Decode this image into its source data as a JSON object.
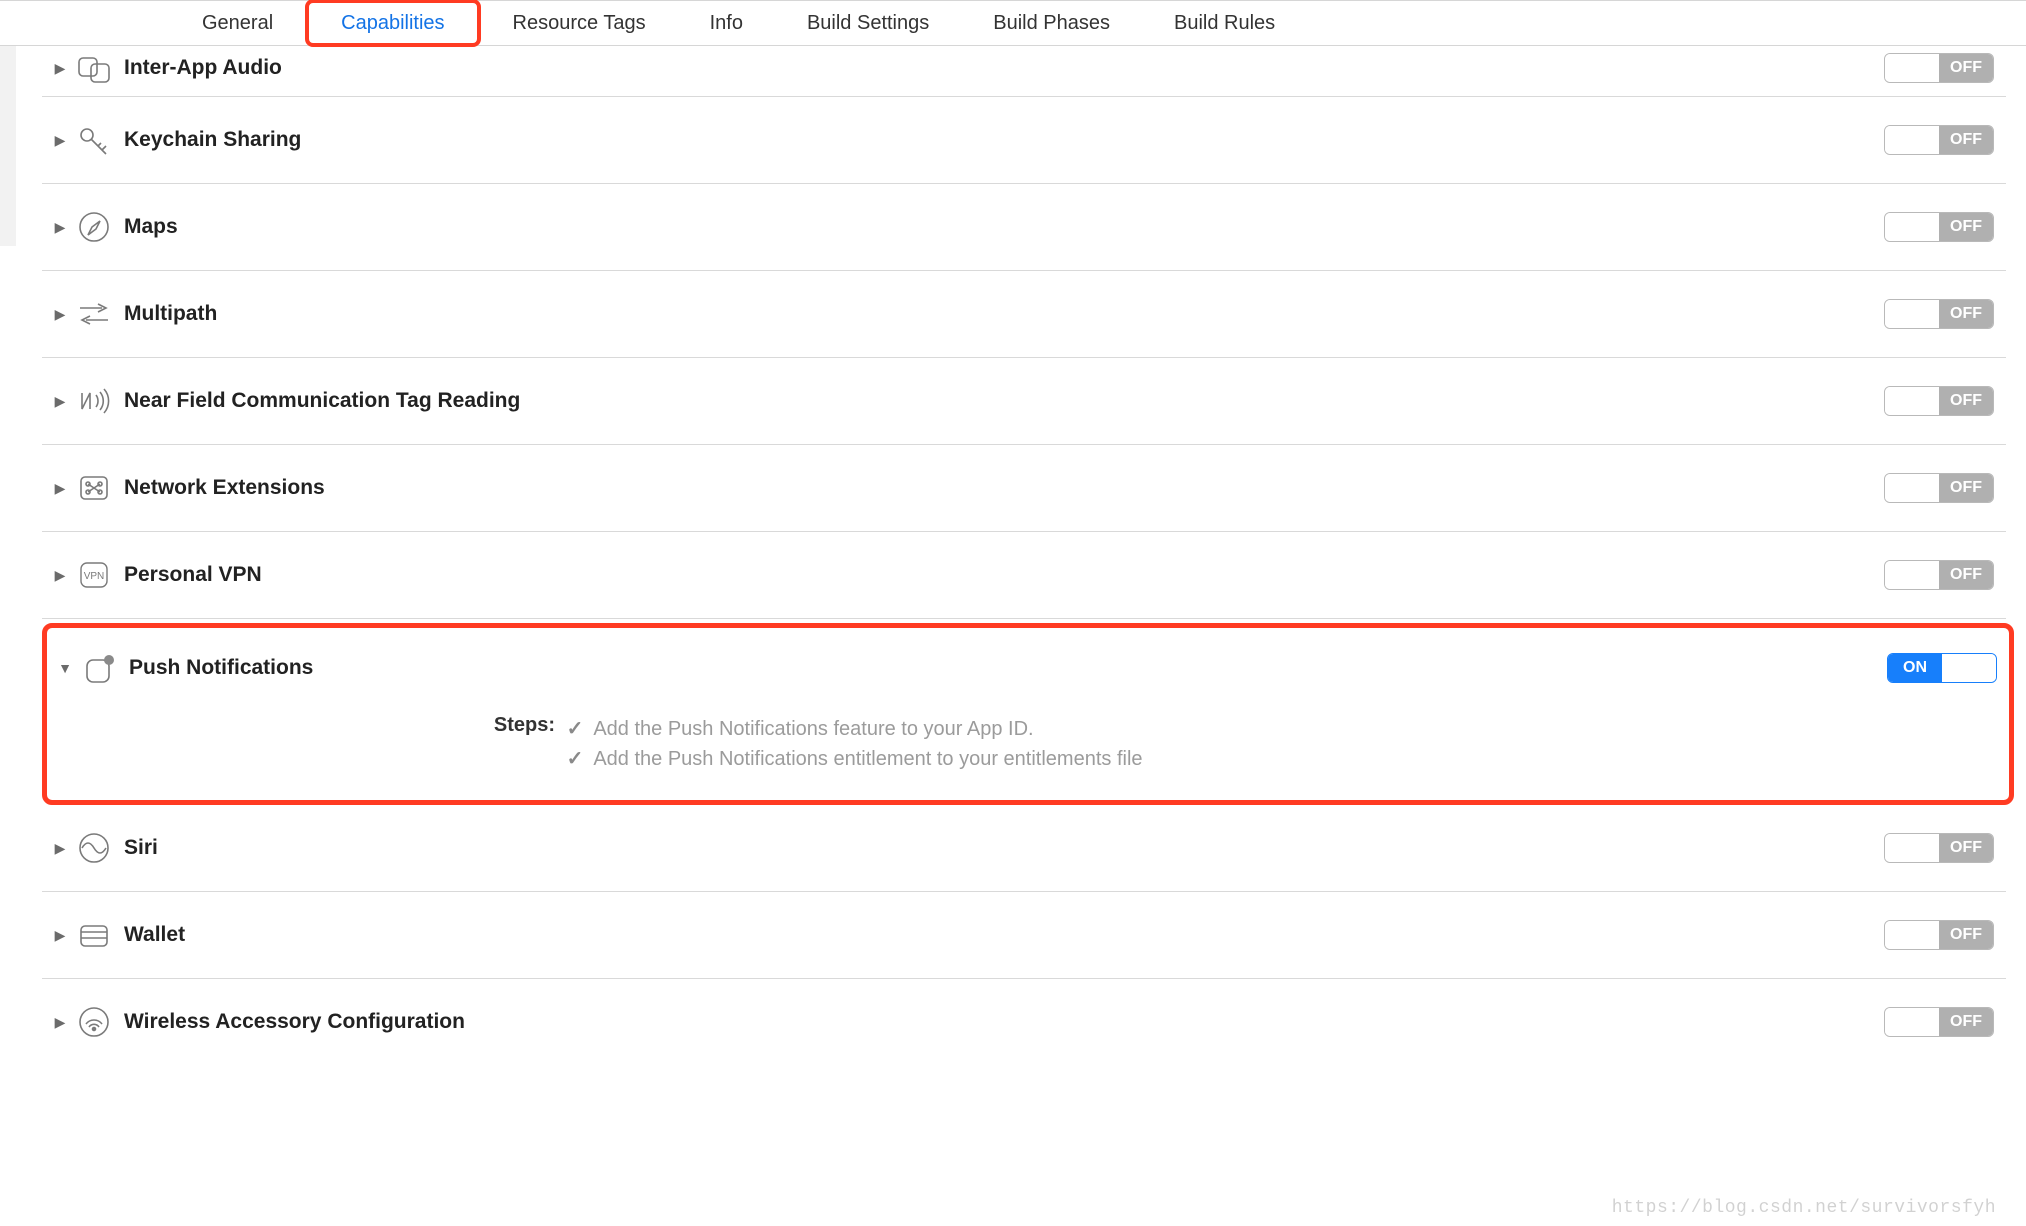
{
  "tabs": {
    "general": "General",
    "capabilities": "Capabilities",
    "resource_tags": "Resource Tags",
    "info": "Info",
    "build_settings": "Build Settings",
    "build_phases": "Build Phases",
    "build_rules": "Build Rules"
  },
  "toggle": {
    "on": "ON",
    "off": "OFF"
  },
  "caps": {
    "inter_app_audio": "Inter-App Audio",
    "keychain_sharing": "Keychain Sharing",
    "maps": "Maps",
    "multipath": "Multipath",
    "nfc": "Near Field Communication Tag Reading",
    "network_ext": "Network Extensions",
    "personal_vpn": "Personal VPN",
    "push": "Push Notifications",
    "siri": "Siri",
    "wallet": "Wallet",
    "wireless_accessory": "Wireless Accessory Configuration"
  },
  "push": {
    "steps_label": "Steps:",
    "step1": "Add the Push Notifications feature to your App ID.",
    "step2": "Add the Push Notifications entitlement to your entitlements file"
  },
  "watermark": "https://blog.csdn.net/survivorsfyh"
}
